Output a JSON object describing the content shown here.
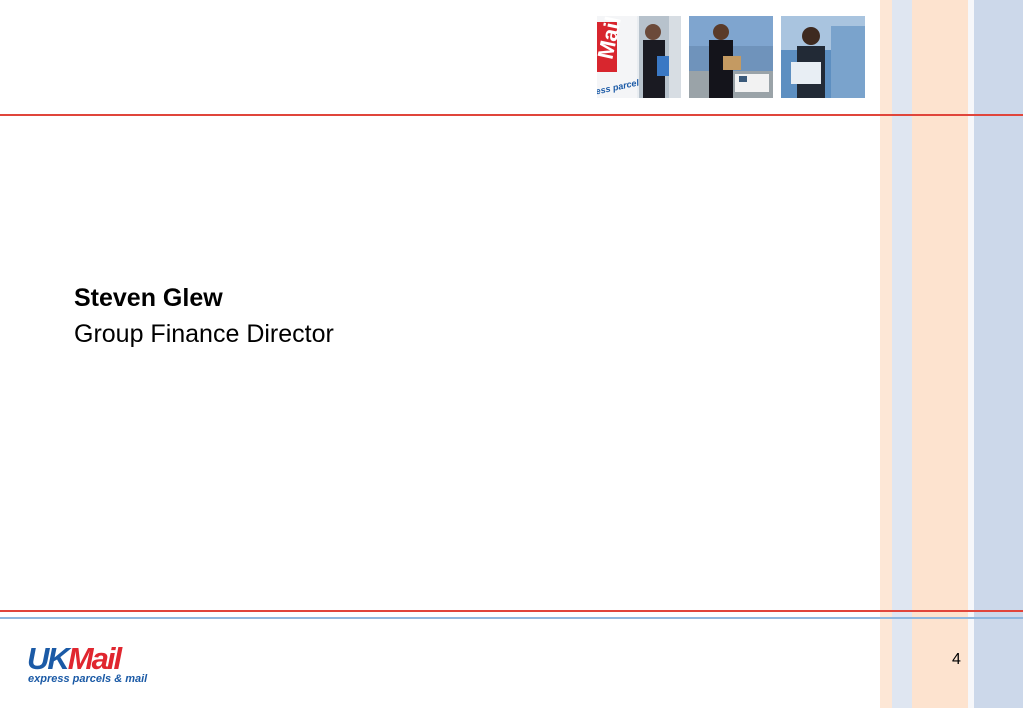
{
  "slide": {
    "name": "Steven Glew",
    "role": "Group Finance Director",
    "page_number": "4"
  },
  "logo": {
    "uk": "UK",
    "mail": "Mail",
    "tagline": "express parcels & mail"
  },
  "photos": [
    {
      "alt": "van-photo",
      "text": "ess parcels & mail"
    },
    {
      "alt": "courier-photo"
    },
    {
      "alt": "office-photo"
    }
  ],
  "colors": {
    "red_rule": "#e0453b",
    "blue_rule": "#8fb8df",
    "brand_blue": "#1b5aa6",
    "brand_red": "#e0262f"
  }
}
